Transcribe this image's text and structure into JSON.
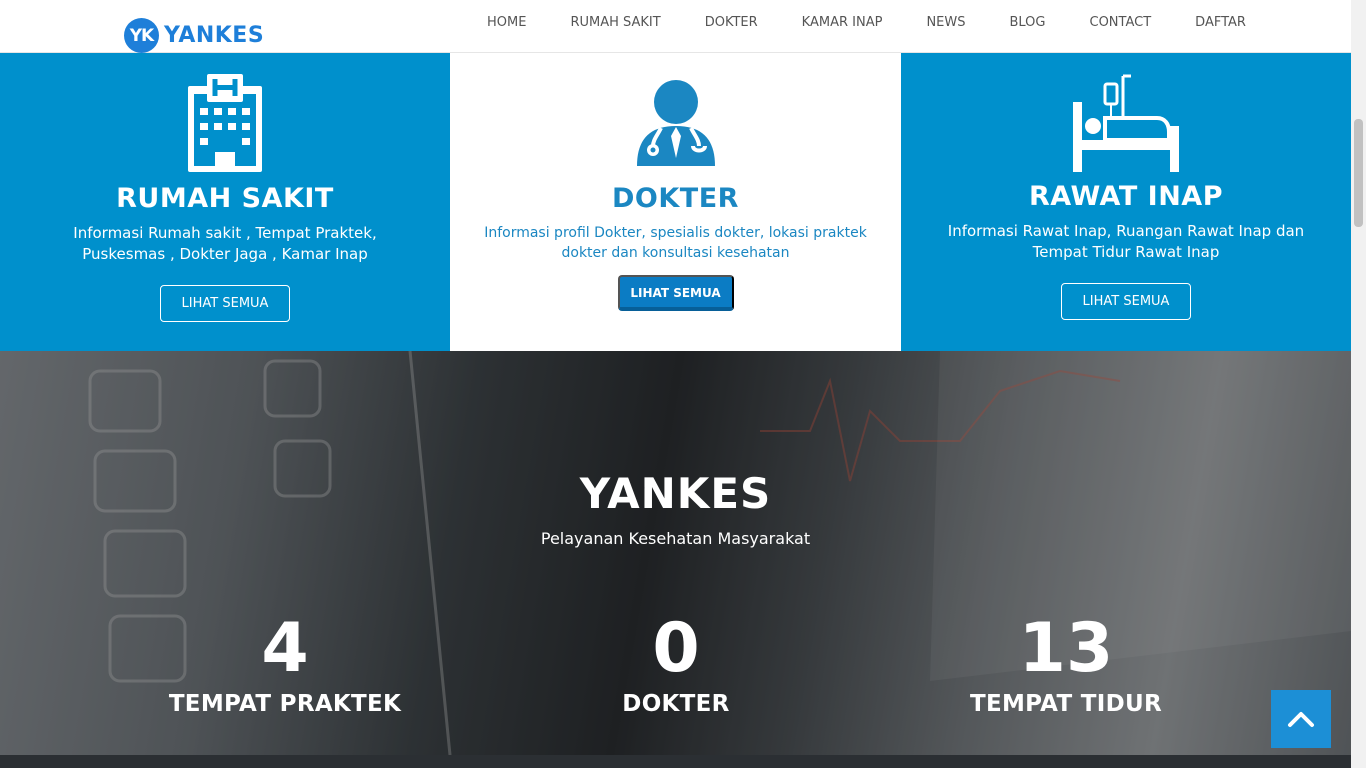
{
  "brand": {
    "badge": "YK",
    "name": "YANKES"
  },
  "nav": [
    "HOME",
    "RUMAH SAKIT",
    "DOKTER",
    "KAMAR INAP",
    "NEWS",
    "BLOG",
    "CONTACT",
    "DAFTAR"
  ],
  "features": [
    {
      "icon": "hospital-building-icon",
      "title": "RUMAH SAKIT",
      "desc": "Informasi Rumah sakit , Tempat Praktek, Puskesmas , Dokter Jaga , Kamar Inap",
      "button": "LIHAT SEMUA"
    },
    {
      "icon": "doctor-icon",
      "title": "DOKTER",
      "desc": "Informasi profil Dokter, spesialis dokter, lokasi praktek dokter dan konsultasi kesehatan",
      "button": "LIHAT SEMUA"
    },
    {
      "icon": "hospital-bed-icon",
      "title": "RAWAT INAP",
      "desc": "Informasi Rawat Inap, Ruangan Rawat Inap dan Tempat Tidur Rawat Inap",
      "button": "LIHAT SEMUA"
    }
  ],
  "hero": {
    "title": "YANKES",
    "subtitle": "Pelayanan Kesehatan Masyarakat",
    "stats": [
      {
        "value": "4",
        "label": "TEMPAT PRAKTEK"
      },
      {
        "value": "0",
        "label": "DOKTER"
      },
      {
        "value": "13",
        "label": "TEMPAT TIDUR"
      }
    ]
  },
  "colors": {
    "primary": "#0090cc",
    "brand": "#1e7fd9",
    "accent_text": "#1b87c2",
    "to_top": "#1c8fd6"
  }
}
